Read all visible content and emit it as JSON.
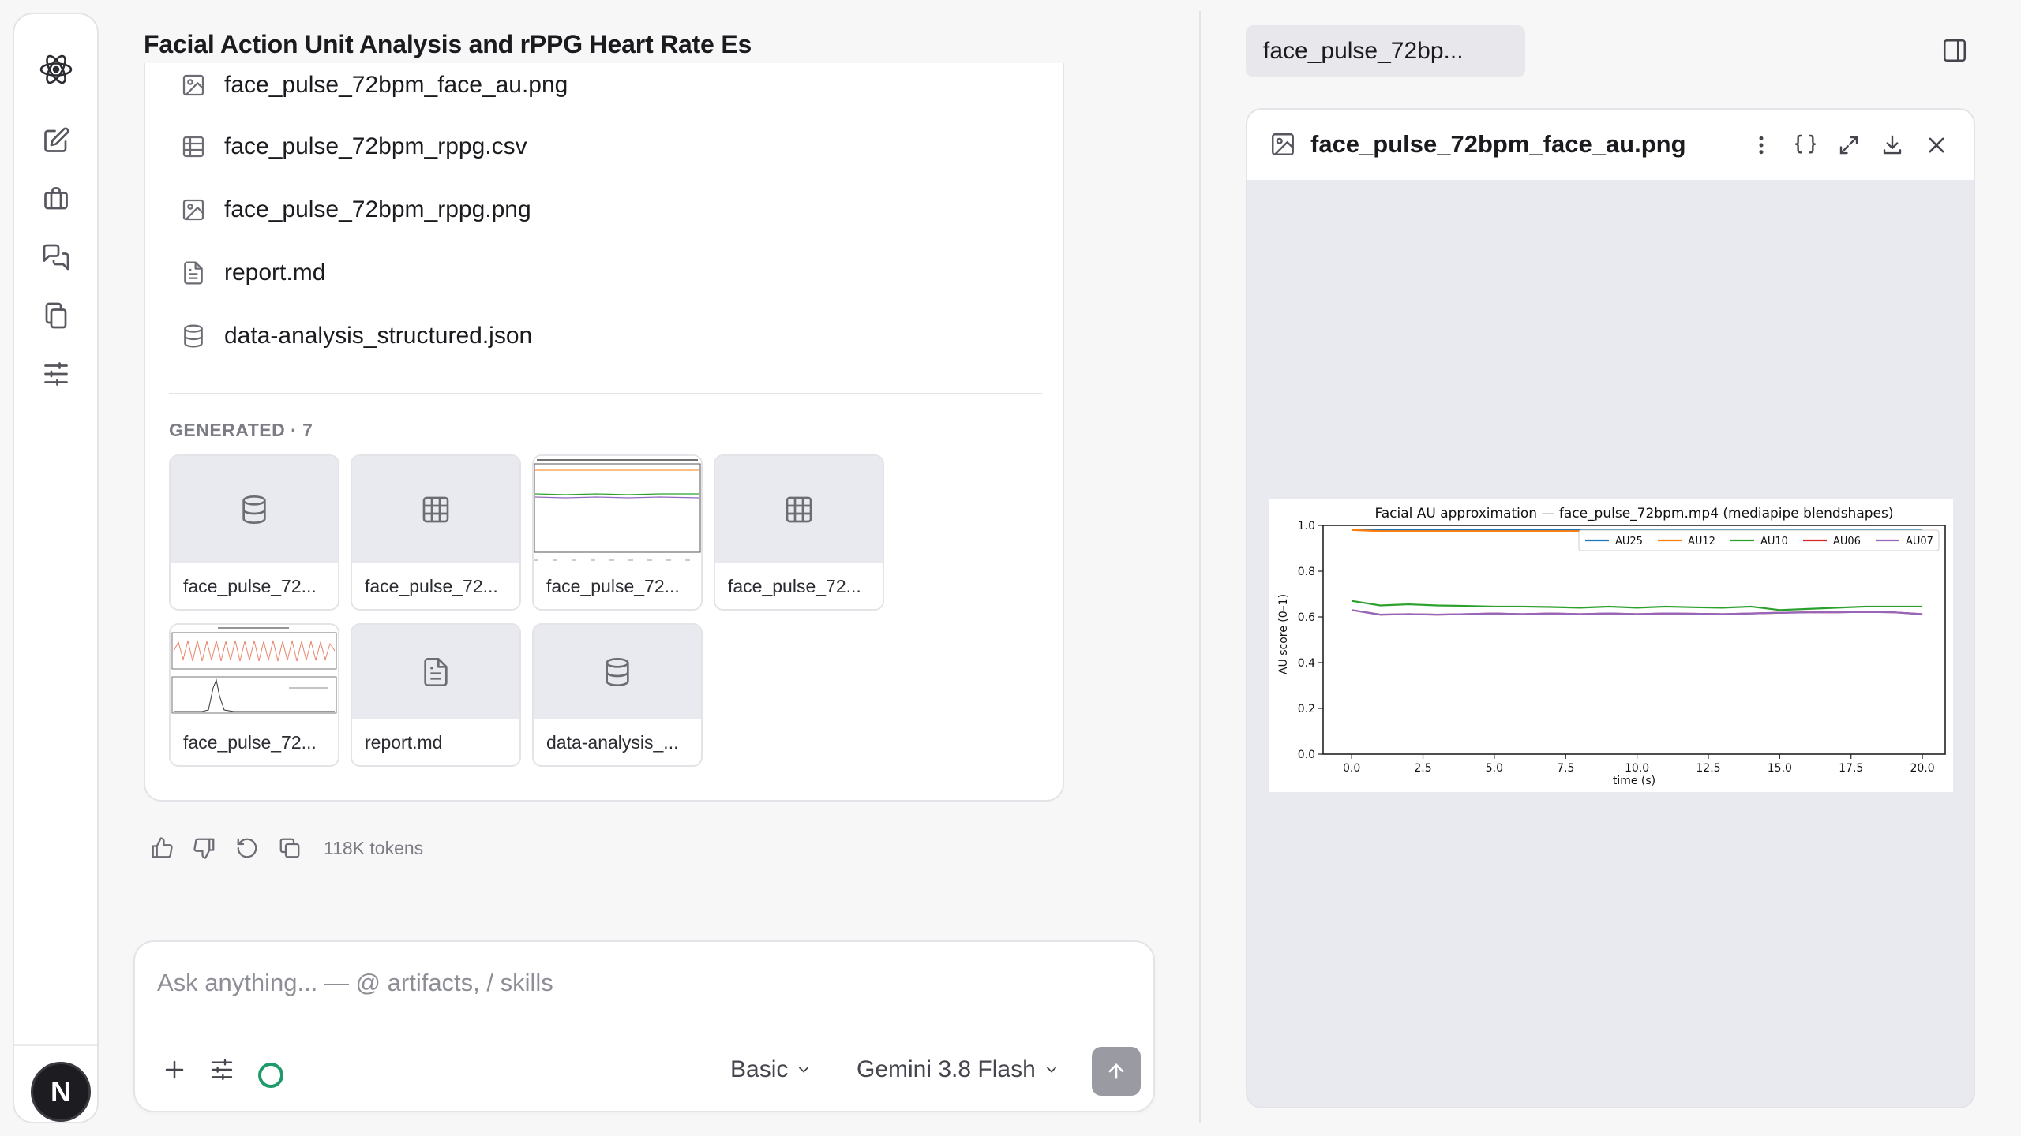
{
  "conversation": {
    "title": "Facial Action Unit Analysis and rPPG Heart Rate Es"
  },
  "files": [
    {
      "name": "face_pulse_72bpm_face_au.png",
      "icon": "image-icon"
    },
    {
      "name": "face_pulse_72bpm_rppg.csv",
      "icon": "table-icon"
    },
    {
      "name": "face_pulse_72bpm_rppg.png",
      "icon": "image-icon"
    },
    {
      "name": "report.md",
      "icon": "document-icon"
    },
    {
      "name": "data-analysis_structured.json",
      "icon": "database-icon"
    }
  ],
  "generated": {
    "label": "GENERATED · 7",
    "tiles": [
      {
        "caption": "face_pulse_72...",
        "icon": "database-icon"
      },
      {
        "caption": "face_pulse_72...",
        "icon": "table-icon"
      },
      {
        "caption": "face_pulse_72...",
        "icon": "chart-thumbnail"
      },
      {
        "caption": "face_pulse_72...",
        "icon": "table-icon"
      },
      {
        "caption": "face_pulse_72...",
        "icon": "chart-thumbnail"
      },
      {
        "caption": "report.md",
        "icon": "document-icon"
      },
      {
        "caption": "data-analysis_...",
        "icon": "database-icon"
      }
    ]
  },
  "message_actions": {
    "tokens": "118K tokens"
  },
  "composer": {
    "placeholder": "Ask anything... — @ artifacts, / skills",
    "mode": "Basic",
    "model": "Gemini 3.8 Flash",
    "status_color": "#1f9a6a"
  },
  "viewer": {
    "tab_label": "face_pulse_72bp...",
    "file_name": "face_pulse_72bpm_face_au.png"
  },
  "avatar": {
    "initial": "N"
  },
  "chart_data": {
    "type": "line",
    "title": "Facial AU approximation — face_pulse_72bpm.mp4 (mediapipe blendshapes)",
    "xlabel": "time (s)",
    "ylabel": "AU score (0–1)",
    "xlim": [
      -1,
      20.8
    ],
    "ylim": [
      0,
      1.0
    ],
    "xticks": [
      "0.0",
      "2.5",
      "5.0",
      "7.5",
      "10.0",
      "12.5",
      "15.0",
      "17.5",
      "20.0"
    ],
    "yticks": [
      "0.0",
      "0.2",
      "0.4",
      "0.6",
      "0.8",
      "1.0"
    ],
    "legend": "top-right",
    "grid": false,
    "x": [
      0,
      1,
      2,
      3,
      4,
      5,
      6,
      7,
      8,
      9,
      10,
      11,
      12,
      13,
      14,
      15,
      16,
      17,
      18,
      19,
      20
    ],
    "series": [
      {
        "name": "AU25",
        "color": "#1f77b4",
        "values": [
          0.98,
          0.98,
          0.98,
          0.98,
          0.98,
          0.98,
          0.98,
          0.98,
          0.98,
          0.98,
          0.98,
          0.98,
          0.98,
          0.98,
          0.98,
          0.98,
          0.98,
          0.98,
          0.98,
          0.98,
          0.98
        ]
      },
      {
        "name": "AU12",
        "color": "#ff7f0e",
        "values": [
          0.98,
          0.975,
          0.975,
          0.975,
          0.975,
          0.975,
          0.975,
          0.975,
          0.975,
          0.975,
          0.975,
          0.975,
          0.975,
          0.975,
          0.975,
          0.975,
          0.975,
          0.975,
          0.975,
          0.975,
          0.975
        ]
      },
      {
        "name": "AU10",
        "color": "#2ca02c",
        "values": [
          0.67,
          0.65,
          0.655,
          0.65,
          0.648,
          0.645,
          0.645,
          0.643,
          0.64,
          0.645,
          0.64,
          0.645,
          0.642,
          0.64,
          0.645,
          0.63,
          0.635,
          0.64,
          0.645,
          0.645,
          0.645
        ]
      },
      {
        "name": "AU06",
        "color": "#d62728",
        "values": [
          0.63,
          0.61,
          0.612,
          0.61,
          0.612,
          0.615,
          0.612,
          0.615,
          0.612,
          0.615,
          0.612,
          0.615,
          0.614,
          0.612,
          0.615,
          0.618,
          0.62,
          0.62,
          0.622,
          0.62,
          0.612
        ]
      },
      {
        "name": "AU07",
        "color": "#9467bd",
        "values": [
          0.63,
          0.61,
          0.612,
          0.61,
          0.612,
          0.615,
          0.612,
          0.615,
          0.612,
          0.615,
          0.612,
          0.615,
          0.614,
          0.612,
          0.615,
          0.618,
          0.62,
          0.62,
          0.622,
          0.62,
          0.612
        ]
      }
    ]
  }
}
